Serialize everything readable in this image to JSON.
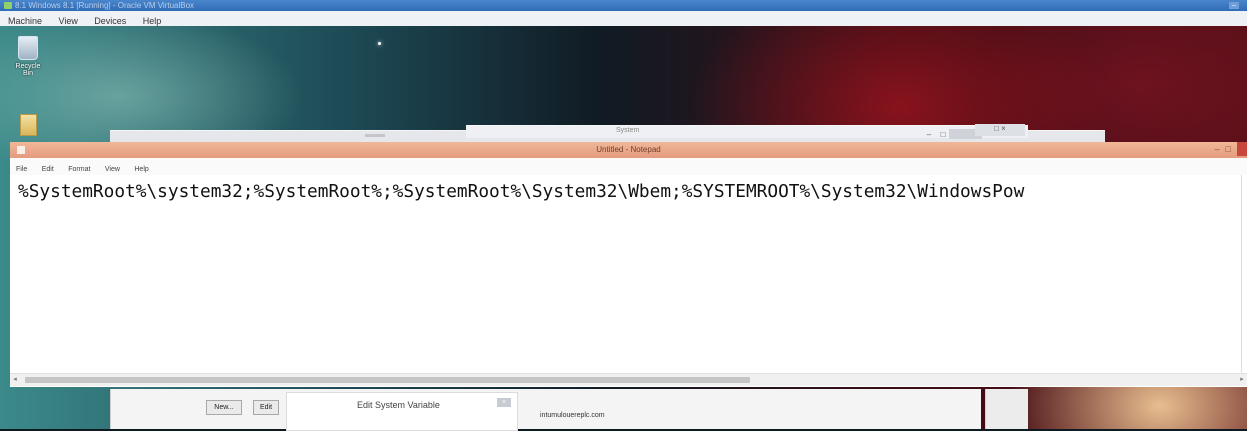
{
  "vbox": {
    "title": "8.1 Windows 8.1 [Running] - Oracle VM VirtualBox",
    "menu": [
      "Machine",
      "View",
      "Devices",
      "Help"
    ]
  },
  "desktop": {
    "recycle_label": "Recycle Bin"
  },
  "background_window": {
    "title": "System"
  },
  "notepad": {
    "title": "Untitled - Notepad",
    "menu": [
      "File",
      "Edit",
      "Format",
      "View",
      "Help"
    ],
    "content": "%SystemRoot%\\system32;%SystemRoot%;%SystemRoot%\\System32\\Wbem;%SYSTEMROOT%\\System32\\WindowsPow"
  },
  "env_dialog": {
    "new_button": "New...",
    "edit_button": "Edit"
  },
  "edit_system_variable": {
    "title": "Edit System Variable"
  },
  "site_text": "intumulouereplc.com"
}
